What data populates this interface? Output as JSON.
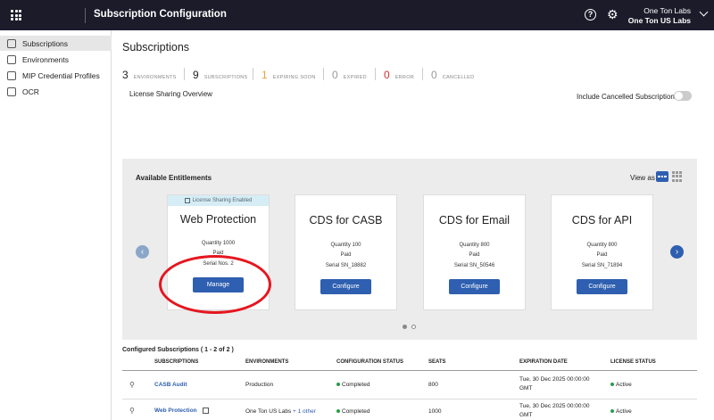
{
  "header": {
    "title": "Subscription Configuration",
    "org_line1": "One Ton Labs",
    "org_line2": "One Ton US Labs",
    "icons": [
      "grid-icon",
      "help-icon",
      "gear-icon",
      "chevron-down-icon"
    ]
  },
  "sidebar": {
    "items": [
      {
        "label": "Subscriptions",
        "active": true,
        "icon": "subscriptions-icon"
      },
      {
        "label": "Environments",
        "active": false,
        "icon": "environments-icon"
      },
      {
        "label": "MIP Credential Profiles",
        "active": false,
        "icon": "credential-icon"
      },
      {
        "label": "OCR",
        "active": false,
        "icon": "ocr-icon"
      }
    ]
  },
  "main": {
    "title": "Subscriptions",
    "stats": [
      {
        "value": "3",
        "label": "ENVIRONMENTS",
        "color": "#222222"
      },
      {
        "value": "9",
        "label": "SUBSCRIPTIONS",
        "color": "#222222"
      },
      {
        "value": "1",
        "label": "EXPIRING SOON",
        "color": "#e8a33d"
      },
      {
        "value": "0",
        "label": "EXPIRED",
        "color": "#999999"
      },
      {
        "value": "0",
        "label": "ERROR",
        "color": "#d32f2f"
      },
      {
        "value": "0",
        "label": "CANCELLED",
        "color": "#999999"
      }
    ],
    "license_sharing_overview": "License Sharing Overview",
    "include_cancelled": "Include Cancelled Subscriptions"
  },
  "entitlements": {
    "title": "Available Entitlements",
    "view_as": "View as",
    "cards": [
      {
        "banner": "License Sharing Enabled",
        "name": "Web Protection",
        "line1": "Quantity 1000",
        "line2": "Paid",
        "line3": "Serial Nos. 2",
        "button": "Manage"
      },
      {
        "banner": "",
        "name": "CDS for CASB",
        "line1": "Quantity 100",
        "line2": "Paid",
        "line3": "Serial SN_18882",
        "button": "Configure"
      },
      {
        "banner": "",
        "name": "CDS for Email",
        "line1": "Quantity 800",
        "line2": "Paid",
        "line3": "Serial SN_50546",
        "button": "Configure"
      },
      {
        "banner": "",
        "name": "CDS for API",
        "line1": "Quantity 800",
        "line2": "Paid",
        "line3": "Serial SN_71894",
        "button": "Configure"
      }
    ]
  },
  "configured": {
    "title": "Configured Subscriptions ( 1 - 2 of 2 )",
    "columns": [
      "SUBSCRIPTIONS",
      "ENVIRONMENTS",
      "CONFIGURATION STATUS",
      "SEATS",
      "EXPIRATION DATE",
      "LICENSE STATUS"
    ],
    "rows": [
      {
        "subscription": "CASB Audit",
        "environment": "Production",
        "env_extra": "",
        "config_status": "Completed",
        "seats": "800",
        "exp_line1": "Tue, 30 Dec 2025 00:00:00",
        "exp_line2": "GMT",
        "license_status": "Active"
      },
      {
        "subscription": "Web Protection",
        "environment": "One Ton US Labs",
        "env_extra": "+ 1 other",
        "config_status": "Completed",
        "seats": "1000",
        "exp_line1": "Tue, 30 Dec 2025 00:00:00",
        "exp_line2": "GMT",
        "license_status": "Active"
      }
    ]
  },
  "colors": {
    "accent": "#2e5fb0",
    "topbar": "#1b1b2a",
    "success": "#2a9d4b",
    "annotation": "#e5161f"
  }
}
